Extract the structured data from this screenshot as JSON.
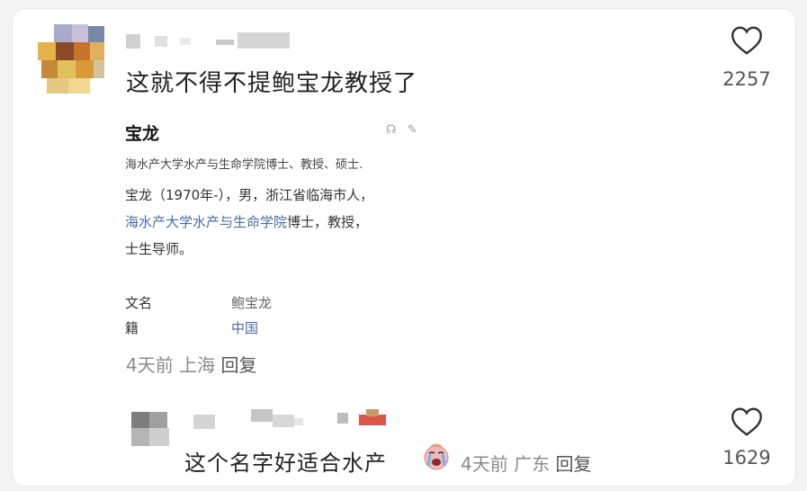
{
  "comments": [
    {
      "text": "这就不得不提鲍宝龙教授了",
      "likes": "2257",
      "time": "4天前",
      "location": "上海",
      "reply_label": "回复",
      "embedded_card": {
        "title": "宝龙",
        "subtitle": "海水产大学水产与生命学院博士、教授、硕士.",
        "line1": "宝龙（1970年-），男，浙江省临海市人，",
        "line2_link": "海水产大学水产与生命学院",
        "line2_rest": "博士，教授，",
        "line3": "士生导师。",
        "info": [
          {
            "key": "文名",
            "value": "鲍宝龙"
          },
          {
            "key": "籍",
            "value": "中国"
          }
        ],
        "tool_icons": [
          "headphones-icon",
          "edit-icon"
        ]
      }
    },
    {
      "text": "这个名字好适合水产",
      "emoji": "crying-face-emoji",
      "likes": "1629",
      "time": "4天前",
      "location": "广东",
      "reply_label": "回复"
    }
  ],
  "icons": {
    "like": "heart-outline-icon"
  },
  "colors": {
    "link": "#4a6aa8",
    "meta": "#8a8a8a",
    "text": "#222222"
  }
}
